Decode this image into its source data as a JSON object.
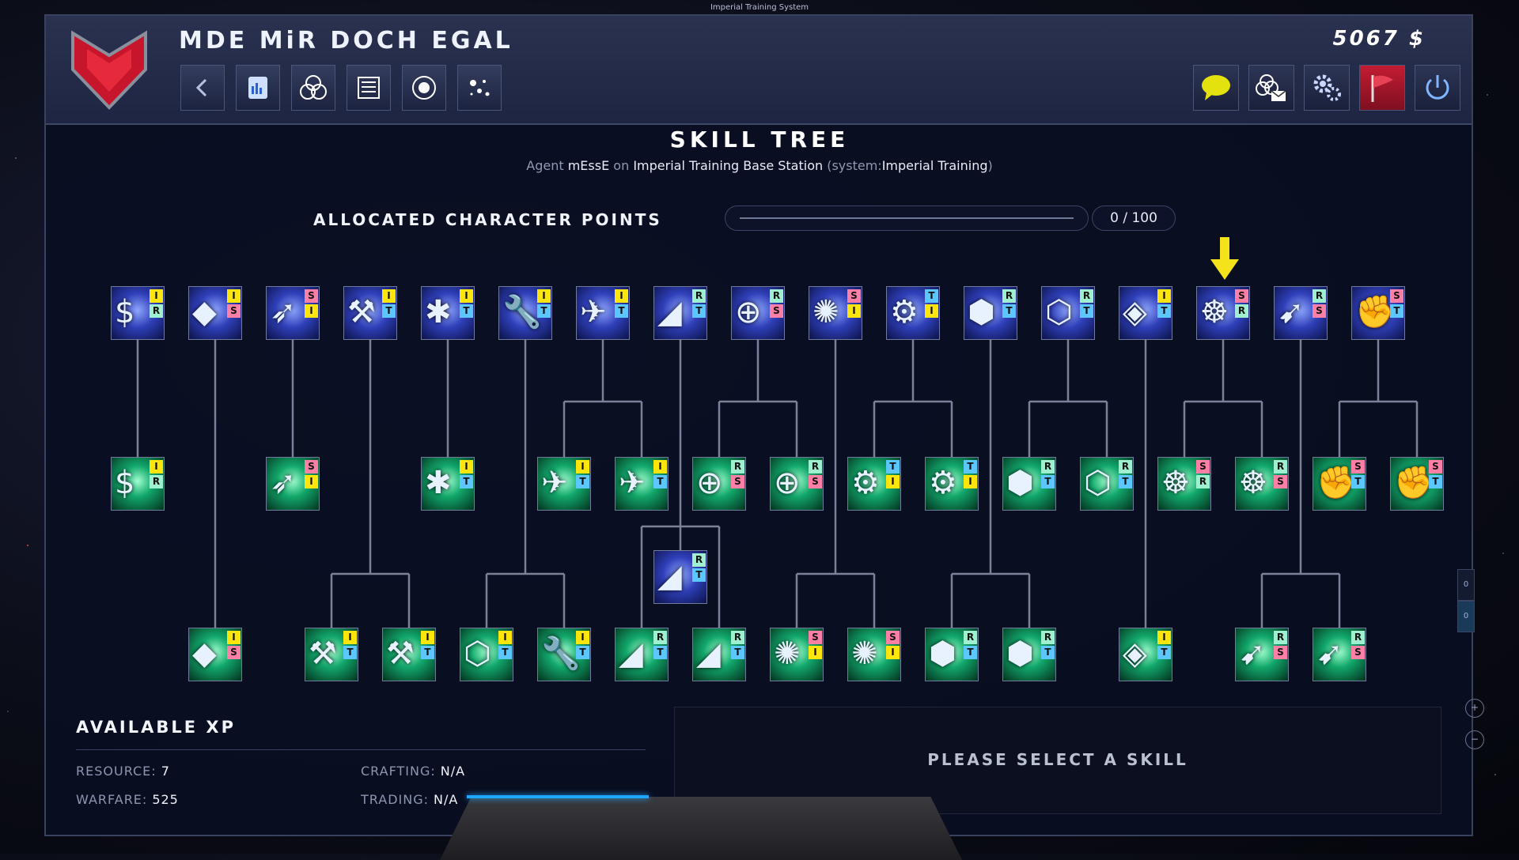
{
  "system_label": "Imperial Training System",
  "header": {
    "title": "MDE MiR DOCH EGAL",
    "credits": "5067 $",
    "nav_icons": [
      "back-arrow-icon",
      "datapad-icon",
      "triple-circle-icon",
      "document-list-icon",
      "radar-icon",
      "star-cluster-icon"
    ],
    "right_icons": [
      "chat-bubble-icon",
      "mail-network-icon",
      "settings-gears-icon",
      "flag-icon",
      "power-icon"
    ],
    "colors": {
      "emblem": "#d01a2e",
      "chat": "#e3e20f",
      "flag_bg": "#b0142a",
      "accent": "#1fa6ff"
    }
  },
  "skill_tree": {
    "title": "SKILL TREE",
    "agent_prefix": "Agent",
    "agent_name": "mEssE",
    "on_word": "on",
    "station": "Imperial Training Base Station",
    "system_open": "(system:",
    "system_name": "Imperial Training",
    "system_close": ")"
  },
  "points": {
    "label": "ALLOCATED CHARACTER POINTS",
    "value": "0 / 100",
    "fraction": 0
  },
  "nodes": {
    "row1": [
      {
        "icon": "money-icon",
        "tags": [
          "I",
          "R"
        ]
      },
      {
        "icon": "ore-icon",
        "tags": [
          "I",
          "S"
        ]
      },
      {
        "icon": "mining-drone-icon",
        "tags": [
          "S",
          "I"
        ]
      },
      {
        "icon": "tools-icon",
        "tags": [
          "I",
          "T"
        ]
      },
      {
        "icon": "puzzle-gear-icon",
        "tags": [
          "I",
          "T"
        ]
      },
      {
        "icon": "wrench-hex-icon",
        "tags": [
          "I",
          "T"
        ]
      },
      {
        "icon": "fighter-ship-icon",
        "tags": [
          "I",
          "T"
        ]
      },
      {
        "icon": "satellite-dish-icon",
        "tags": [
          "R",
          "T"
        ]
      },
      {
        "icon": "crosshair-icon",
        "tags": [
          "R",
          "S"
        ]
      },
      {
        "icon": "energy-orb-icon",
        "tags": [
          "S",
          "I"
        ]
      },
      {
        "icon": "gear-icon",
        "tags": [
          "T",
          "I"
        ]
      },
      {
        "icon": "hex-armor-icon",
        "tags": [
          "R",
          "T"
        ]
      },
      {
        "icon": "honeycomb-icon",
        "tags": [
          "R",
          "T"
        ]
      },
      {
        "icon": "crystal-icon",
        "tags": [
          "I",
          "T"
        ]
      },
      {
        "icon": "ship-wheel-icon",
        "tags": [
          "S",
          "R"
        ]
      },
      {
        "icon": "missile-ship-icon",
        "tags": [
          "R",
          "S"
        ]
      },
      {
        "icon": "fist-icon",
        "tags": [
          "S",
          "T"
        ]
      }
    ],
    "row2": [
      {
        "icon": "money-icon",
        "tags": [
          "I",
          "R"
        ]
      },
      {
        "icon": "mining-drone-icon",
        "tags": [
          "S",
          "I"
        ]
      },
      {
        "icon": "puzzle-gear-icon",
        "tags": [
          "I",
          "T"
        ]
      },
      {
        "icon": "fighter-ship-icon",
        "tags": [
          "I",
          "T"
        ]
      },
      {
        "icon": "fighter-ship-icon",
        "tags": [
          "I",
          "T"
        ]
      },
      {
        "icon": "crosshair-icon",
        "tags": [
          "R",
          "S"
        ]
      },
      {
        "icon": "crosshair-icon",
        "tags": [
          "R",
          "S"
        ]
      },
      {
        "icon": "honeycomb-gear-icon",
        "tags": [
          "T",
          "I"
        ]
      },
      {
        "icon": "hex-gear-icon",
        "tags": [
          "T",
          "I"
        ]
      },
      {
        "icon": "hex-armor-icon",
        "tags": [
          "R",
          "T"
        ]
      },
      {
        "icon": "honeycomb-icon",
        "tags": [
          "R",
          "T"
        ]
      },
      {
        "icon": "ship-wheel-icon",
        "tags": [
          "S",
          "R"
        ]
      },
      {
        "icon": "ship-wheel-icon",
        "tags": [
          "R",
          "S"
        ]
      },
      {
        "icon": "fist-icon",
        "tags": [
          "S",
          "T"
        ]
      },
      {
        "icon": "fist-icon",
        "tags": [
          "S",
          "T"
        ]
      }
    ],
    "row3": [
      {
        "icon": "satellite-dish-icon",
        "tags": [
          "R",
          "T"
        ]
      }
    ],
    "row4": [
      {
        "icon": "ore-icon",
        "tags": [
          "I",
          "S"
        ]
      },
      {
        "icon": "tools-icon",
        "tags": [
          "I",
          "T"
        ]
      },
      {
        "icon": "tools-icon",
        "tags": [
          "I",
          "T"
        ]
      },
      {
        "icon": "honeycomb-icon",
        "tags": [
          "I",
          "T"
        ]
      },
      {
        "icon": "wrench-hex-icon",
        "tags": [
          "I",
          "T"
        ]
      },
      {
        "icon": "satellite-dish-icon",
        "tags": [
          "R",
          "T"
        ]
      },
      {
        "icon": "satellite-dish-icon",
        "tags": [
          "R",
          "T"
        ]
      },
      {
        "icon": "energy-orb-icon",
        "tags": [
          "S",
          "I"
        ]
      },
      {
        "icon": "energy-orb-icon",
        "tags": [
          "S",
          "I"
        ]
      },
      {
        "icon": "hex-armor-icon",
        "tags": [
          "R",
          "T"
        ]
      },
      {
        "icon": "hex-armor-icon",
        "tags": [
          "R",
          "T"
        ]
      },
      {
        "icon": "crystal-icon",
        "tags": [
          "I",
          "T"
        ]
      },
      {
        "icon": "missile-ship-icon",
        "tags": [
          "R",
          "S"
        ]
      },
      {
        "icon": "missile-ship-icon",
        "tags": [
          "R",
          "S"
        ]
      }
    ]
  },
  "xp": {
    "title": "AVAILABLE XP",
    "resource_label": "RESOURCE:",
    "resource_value": "7",
    "warfare_label": "WARFARE:",
    "warfare_value": "525",
    "crafting_label": "CRAFTING:",
    "crafting_value": "N/A",
    "trading_label": "TRADING:",
    "trading_value": "N/A"
  },
  "select_panel": {
    "text": "PLEASE SELECT A SKILL"
  }
}
